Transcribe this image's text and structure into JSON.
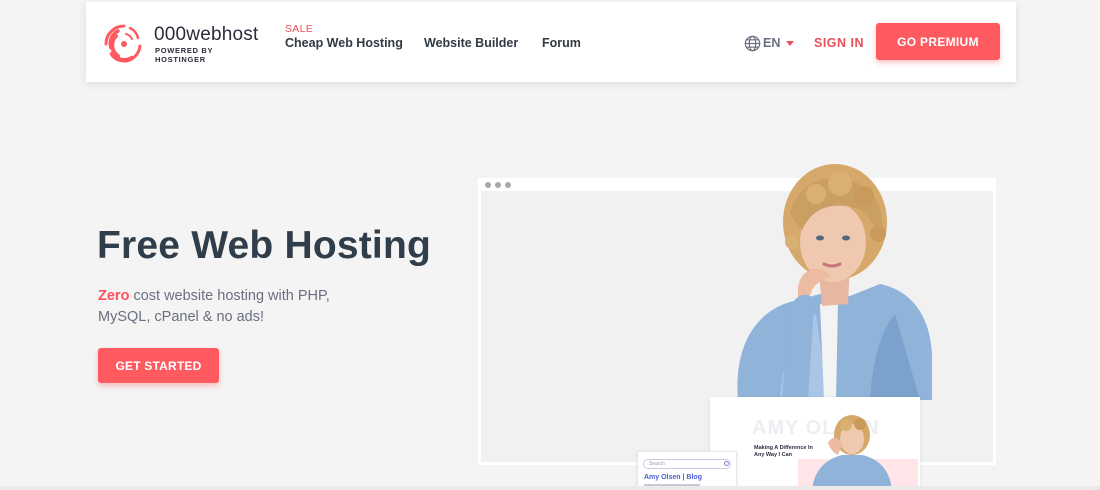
{
  "header": {
    "logo": {
      "name": "000webhost",
      "tagline": "POWERED BY HOSTINGER",
      "icon": "swirl-logo-icon"
    },
    "nav": {
      "sale_tag": "SALE",
      "items": [
        "Cheap Web Hosting",
        "Website Builder",
        "Forum"
      ]
    },
    "language": {
      "icon": "globe-icon",
      "label": "EN"
    },
    "signin_label": "SIGN IN",
    "premium_label": "GO PREMIUM"
  },
  "hero": {
    "title": "Free Web Hosting",
    "desc_accent": "Zero",
    "desc_rest": " cost website hosting with PHP, MySQL, cPanel & no ads!",
    "cta_label": "GET STARTED"
  },
  "mockup": {
    "blog_card": {
      "search_placeholder": "Search",
      "title": "Amy Olsen | Blog"
    },
    "post_card": {
      "name": "AMY OLSEN",
      "headline": "Making A Difference In Any Way I Can"
    }
  },
  "colors": {
    "accent": "#ff5a60",
    "accent_text": "#e8505b",
    "heading": "#2f3e4a",
    "body_text": "#6b6f80",
    "background": "#f4f4f4"
  }
}
